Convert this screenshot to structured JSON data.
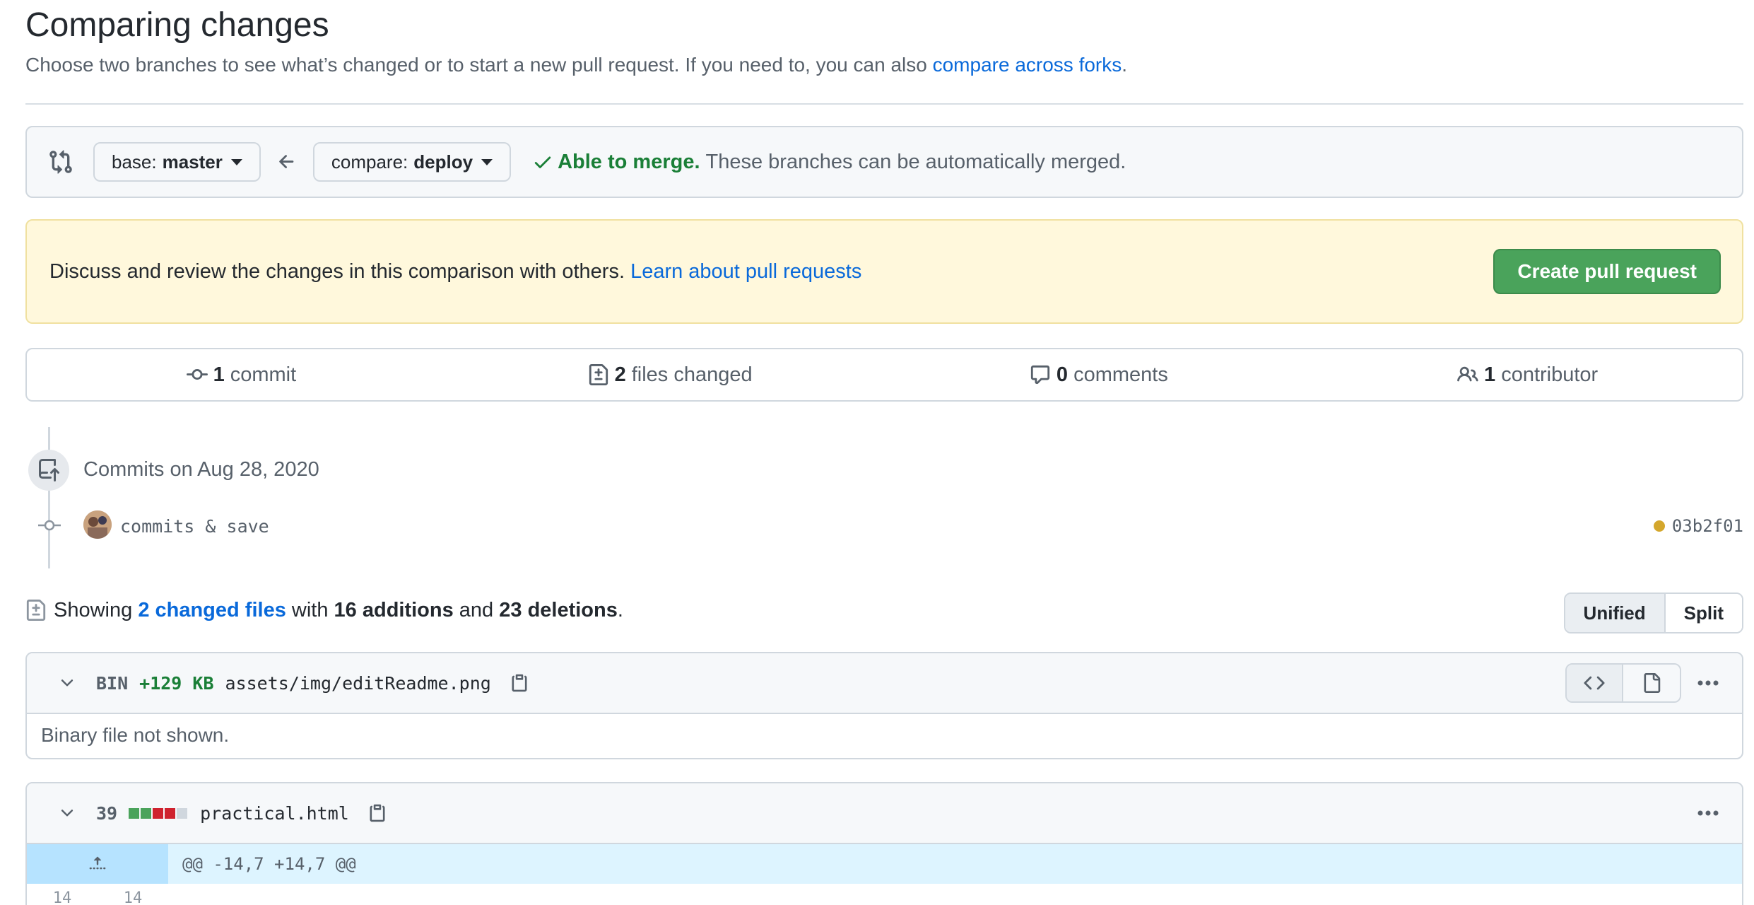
{
  "header": {
    "title": "Comparing changes",
    "subtitle_prefix": "Choose two branches to see what’s changed or to start a new pull request. If you need to, you can also ",
    "subtitle_link": "compare across forks",
    "subtitle_suffix": "."
  },
  "range": {
    "base_label": "base:",
    "base_branch": "master",
    "compare_label": "compare:",
    "compare_branch": "deploy",
    "merge_status": "Able to merge.",
    "merge_detail": "These branches can be automatically merged."
  },
  "flash": {
    "text": "Discuss and review the changes in this comparison with others. ",
    "link": "Learn about pull requests",
    "button": "Create pull request"
  },
  "summary": {
    "commits_count": "1",
    "commits_label": "commit",
    "files_count": "2",
    "files_label": "files changed",
    "comments_count": "0",
    "comments_label": "comments",
    "contributors_count": "1",
    "contributors_label": "contributor"
  },
  "commits": {
    "date_heading": "Commits on Aug 28, 2020",
    "items": [
      {
        "message": "commits & save",
        "sha": "03b2f01",
        "status_color": "#d4a72c"
      }
    ]
  },
  "diff_summary": {
    "showing": "Showing",
    "changed_files": "2 changed files",
    "with": "with",
    "additions": "16 additions",
    "and": "and",
    "deletions": "23 deletions",
    "end": ".",
    "view_unified": "Unified",
    "view_split": "Split"
  },
  "files": [
    {
      "type": "BIN",
      "size": "+129 KB",
      "name": "assets/img/editReadme.png",
      "body": "Binary file not shown."
    },
    {
      "changes": "39",
      "name": "practical.html",
      "diffstat": [
        "add",
        "add",
        "del",
        "del",
        "neutral"
      ],
      "hunk": "@@ -14,7 +14,7 @@",
      "line_left": "14",
      "line_right": "14"
    }
  ],
  "colors": {
    "add": "#4aa35b",
    "del": "#cf222e",
    "neutral": "#d0d7de",
    "accent": "#0969da"
  }
}
